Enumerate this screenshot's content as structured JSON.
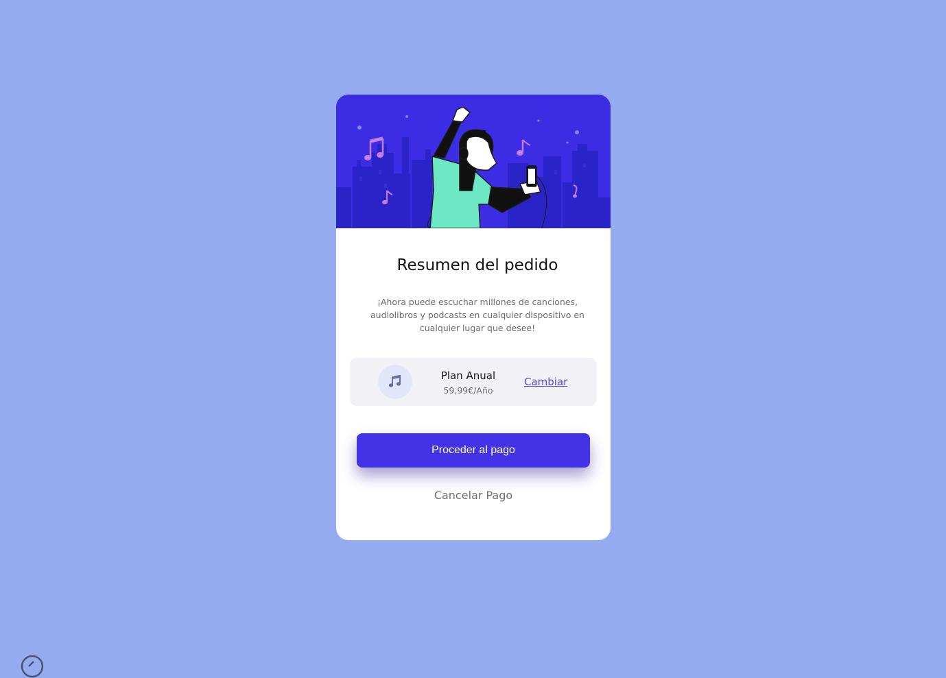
{
  "order": {
    "title": "Resumen del pedido",
    "description": "¡Ahora puede escuchar millones de canciones, audiolibros y podcasts en cualquier dispositivo en cualquier lugar que desee!",
    "plan": {
      "name": "Plan Anual",
      "price": "59,99€/Año",
      "change_label": "Cambiar",
      "icon": "music-note-icon"
    },
    "pay_button_label": "Proceder al pago",
    "cancel_label": "Cancelar Pago"
  },
  "colors": {
    "page_background": "#94abf0",
    "card_background": "#ffffff",
    "hero_background": "#3c2ce3",
    "primary_button": "#4432e6",
    "link": "#5846d9",
    "plan_box": "#f2f2f6",
    "figure_shirt": "#6ee8c4",
    "music_notes": "#c77de9"
  }
}
